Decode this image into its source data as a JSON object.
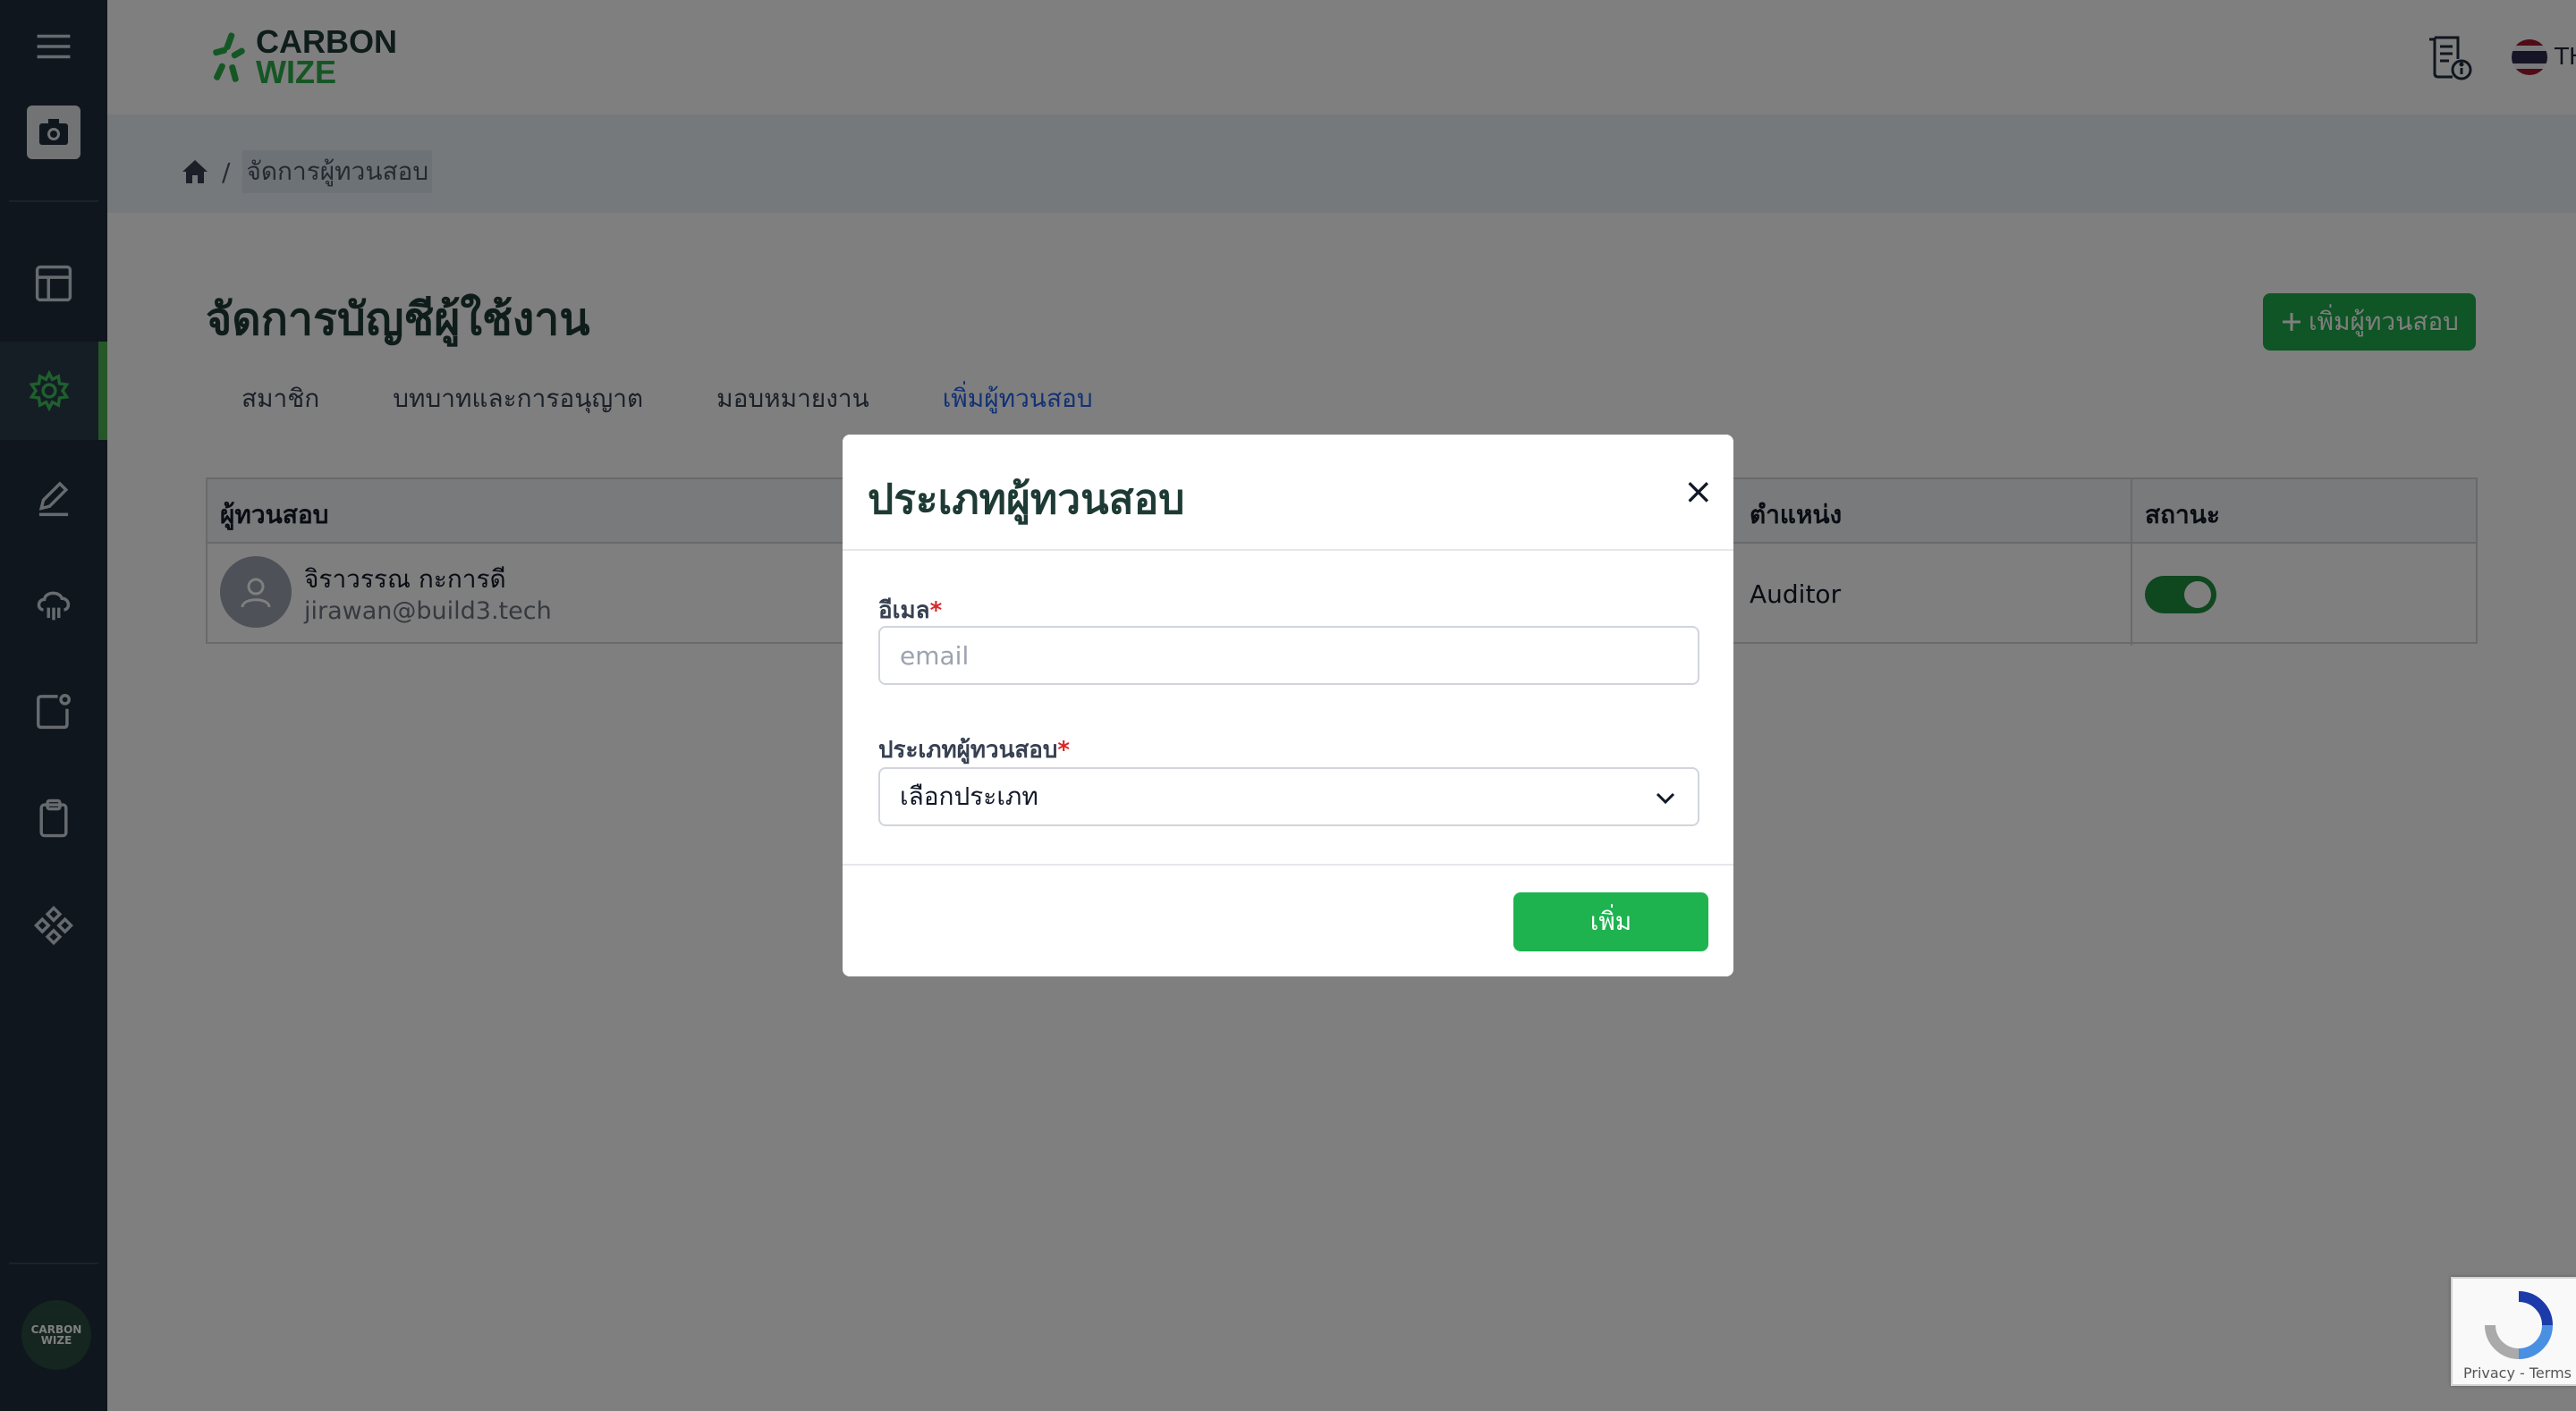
{
  "brand": {
    "line1": "CARBON",
    "line2": "WIZE",
    "sidebar_logo": "CARBON WIZE"
  },
  "sidebar": {
    "items": [
      {
        "icon": "menu-icon"
      },
      {
        "icon": "camera-icon"
      },
      {
        "icon": "layout-icon"
      },
      {
        "icon": "gear-icon",
        "active": true
      },
      {
        "icon": "edit-icon"
      },
      {
        "icon": "cloud-icon"
      },
      {
        "icon": "notification-box-icon"
      },
      {
        "icon": "clipboard-icon"
      },
      {
        "icon": "components-icon"
      }
    ]
  },
  "header": {
    "language": "TH",
    "doc_icon": "document-info-icon"
  },
  "breadcrumb": {
    "separator": "/",
    "current": "จัดการผู้ทวนสอบ"
  },
  "page": {
    "title": "จัดการบัญชีผู้ใช้งาน",
    "add_button": "เพิ่มผู้ทวนสอบ",
    "tabs": [
      {
        "label": "สมาชิก"
      },
      {
        "label": "บทบาทและการอนุญาต"
      },
      {
        "label": "มอบหมายงาน"
      },
      {
        "label": "เพิ่มผู้ทวนสอบ",
        "active": true
      }
    ]
  },
  "table": {
    "headers": {
      "verifier": "ผู้ทวนสอบ",
      "position": "ตำแหน่ง",
      "status": "สถานะ"
    },
    "rows": [
      {
        "name": "จิราวรรณ กะการดี",
        "email": "jirawan@build3.tech",
        "position": "Auditor",
        "status_on": true
      }
    ]
  },
  "modal": {
    "title": "ประเภทผู้ทวนสอบ",
    "close": "×",
    "email_label": "อีเมล",
    "email_placeholder": "email",
    "email_value": "",
    "type_label": "ประเภทผู้ทวนสอบ",
    "type_selected": "เลือกประเภท",
    "required_mark": "*",
    "submit": "เพิ่ม"
  },
  "recaptcha": {
    "links": "Privacy - Terms"
  },
  "colors": {
    "accent": "#1faa4b",
    "sidebar_bg": "#1e2d3d",
    "title": "#1e3a34",
    "active_tab": "#2563eb"
  }
}
